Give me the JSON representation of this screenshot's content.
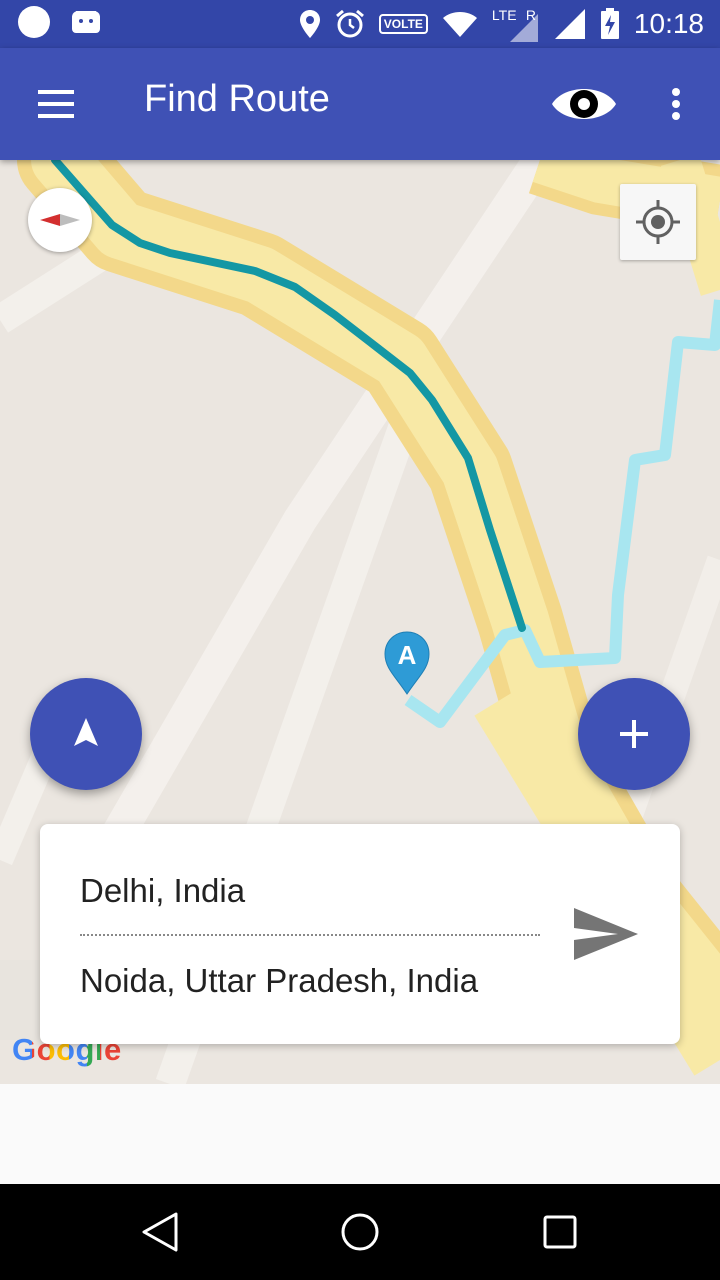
{
  "status_bar": {
    "time": "10:18",
    "volte_label": "VOLTE",
    "lte_label": "LTE",
    "roaming_label": "R",
    "icons": [
      "notification-circle-icon",
      "android-bot-icon",
      "location-pin-icon",
      "alarm-clock-icon",
      "volte-icon",
      "wifi-icon",
      "lte-signal-icon",
      "cell-signal-icon",
      "battery-charging-icon"
    ]
  },
  "toolbar": {
    "title": "Find Route",
    "icons": [
      "hamburger-menu-icon",
      "eye-icon",
      "overflow-menu-icon"
    ]
  },
  "map": {
    "marker_label": "A",
    "logo_text": "Google",
    "colors": {
      "land": "#ebe6e0",
      "major_road": "#f8e9a6",
      "major_road_edge": "#f3d88a",
      "route_primary": "#1497a4",
      "route_alternate": "#a8e6f0",
      "marker": "#2e9bd6"
    }
  },
  "route": {
    "origin": "Delhi, India",
    "destination": "Noida, Uttar Pradesh, India"
  },
  "colors": {
    "accent": "#3f51b5",
    "status_bar": "#3346a8"
  }
}
